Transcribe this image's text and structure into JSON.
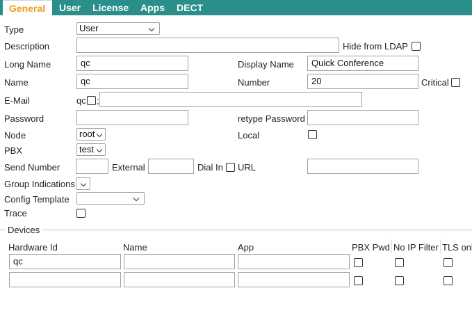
{
  "tabs": {
    "general": "General",
    "user": "User",
    "license": "License",
    "apps": "Apps",
    "dect": "DECT"
  },
  "form": {
    "type_label": "Type",
    "type_value": "User",
    "description_label": "Description",
    "description_value": "",
    "hide_ldap_label": "Hide from LDAP",
    "long_name_label": "Long Name",
    "long_name_value": "qc",
    "display_name_label": "Display Name",
    "display_name_value": "Quick Conference",
    "name_label": "Name",
    "name_value": "qc",
    "number_label": "Number",
    "number_value": "20",
    "critical_label": "Critical",
    "email_label": "E-Mail",
    "email_prefix": "qc",
    "email_separator": ";",
    "email_value": "",
    "password_label": "Password",
    "retype_password_label": "retype Password",
    "node_label": "Node",
    "node_value": "root",
    "local_label": "Local",
    "pbx_label": "PBX",
    "pbx_value": "test",
    "send_number_label": "Send Number",
    "send_number_value": "",
    "external_label": "External",
    "external_value": "",
    "dial_in_label": "Dial In",
    "url_label": "URL",
    "url_value": "",
    "group_indications_label": "Group Indications",
    "config_template_label": "Config Template",
    "config_template_value": "",
    "trace_label": "Trace"
  },
  "devices": {
    "title": "Devices",
    "headers": {
      "hardware_id": "Hardware Id",
      "name": "Name",
      "app": "App",
      "pbx_pwd": "PBX Pwd",
      "no_ip_filter": "No IP Filter",
      "tls_only": "TLS onl"
    },
    "rows": [
      {
        "hardware_id": "qc",
        "name": "",
        "app": ""
      },
      {
        "hardware_id": "",
        "name": "",
        "app": ""
      }
    ]
  }
}
